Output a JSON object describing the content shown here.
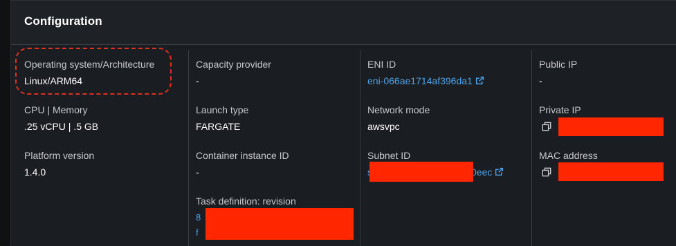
{
  "panel": {
    "title": "Configuration"
  },
  "columns": [
    {
      "fields": [
        {
          "label": "Operating system/Architecture",
          "value": "Linux/ARM64"
        },
        {
          "label": "CPU | Memory",
          "value": ".25 vCPU | .5 GB"
        },
        {
          "label": "Platform version",
          "value": "1.4.0"
        }
      ]
    },
    {
      "fields": [
        {
          "label": "Capacity provider",
          "value": "-"
        },
        {
          "label": "Launch type",
          "value": "FARGATE"
        },
        {
          "label": "Container instance ID",
          "value": "-"
        },
        {
          "label": "Task definition: revision",
          "value": "redacted"
        }
      ]
    },
    {
      "fields": [
        {
          "label": "ENI ID",
          "value": "eni-066ae1714af396da1"
        },
        {
          "label": "Network mode",
          "value": "awsvpc"
        },
        {
          "label": "Subnet ID",
          "value_prefix": "s",
          "value_suffix": "0eec"
        }
      ]
    },
    {
      "fields": [
        {
          "label": "Public IP",
          "value": "-"
        },
        {
          "label": "Private IP",
          "value": "redacted"
        },
        {
          "label": "MAC address",
          "value": "redacted"
        }
      ]
    }
  ],
  "icons": {
    "external_link": "external-link-icon",
    "copy": "copy-icon"
  },
  "colors": {
    "background": "#1a1d21",
    "label": "#c6c9cd",
    "value": "#ffffff",
    "link": "#4da3ea",
    "redaction": "#ff2600",
    "highlight": "#e0301e"
  }
}
